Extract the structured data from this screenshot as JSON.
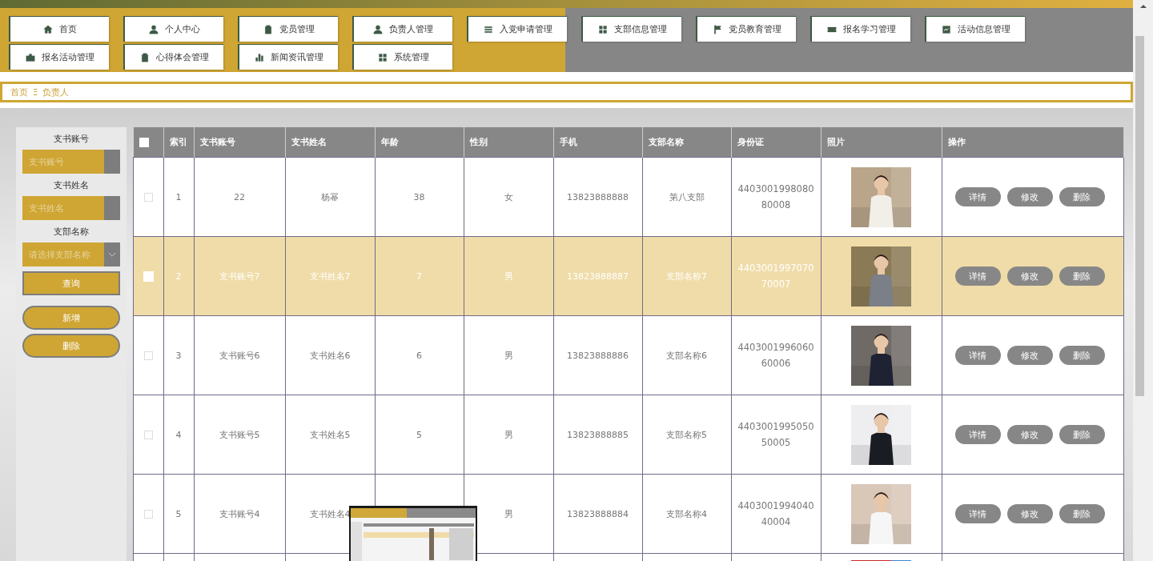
{
  "nav": [
    {
      "label": "首页"
    },
    {
      "label": "个人中心"
    },
    {
      "label": "党员管理"
    },
    {
      "label": "负责人管理"
    },
    {
      "label": "入党申请管理"
    },
    {
      "label": "支部信息管理"
    },
    {
      "label": "党员教育管理"
    },
    {
      "label": "报名学习管理"
    },
    {
      "label": "活动信息管理"
    },
    {
      "label": "报名活动管理"
    },
    {
      "label": "心得体会管理"
    },
    {
      "label": "新闻资讯管理"
    },
    {
      "label": "系统管理"
    }
  ],
  "breadcrumb": {
    "home": "首页",
    "separator": "Ξ",
    "current": "负责人"
  },
  "search": {
    "fields": [
      {
        "label": "支书账号",
        "placeholder": "支书账号",
        "kind": "input"
      },
      {
        "label": "支书姓名",
        "placeholder": "支书姓名",
        "kind": "input"
      },
      {
        "label": "支部名称",
        "placeholder": "请选择支部名称",
        "kind": "select"
      }
    ],
    "query_button": "查询",
    "add_button": "新增",
    "delete_button": "删除"
  },
  "table": {
    "columns": [
      "索引",
      "支书账号",
      "支书姓名",
      "年龄",
      "性别",
      "手机",
      "支部名称",
      "身份证",
      "照片",
      "操作"
    ],
    "select_all": false,
    "rows": [
      {
        "index": "1",
        "account": "22",
        "name": "杨幂",
        "age": "38",
        "gender": "女",
        "phone": "13823888888",
        "branch": "第八支部",
        "id_card": "440300199808080008",
        "selected": false,
        "actions": [
          "详情",
          "修改",
          "删除"
        ]
      },
      {
        "index": "2",
        "account": "支书账号7",
        "name": "支书姓名7",
        "age": "7",
        "gender": "男",
        "phone": "13823888887",
        "branch": "支部名称7",
        "id_card": "440300199707070007",
        "selected": true,
        "actions": [
          "详情",
          "修改",
          "删除"
        ]
      },
      {
        "index": "3",
        "account": "支书账号6",
        "name": "支书姓名6",
        "age": "6",
        "gender": "男",
        "phone": "13823888886",
        "branch": "支部名称6",
        "id_card": "440300199606060006",
        "selected": false,
        "actions": [
          "详情",
          "修改",
          "删除"
        ]
      },
      {
        "index": "4",
        "account": "支书账号5",
        "name": "支书姓名5",
        "age": "5",
        "gender": "男",
        "phone": "13823888885",
        "branch": "支部名称5",
        "id_card": "440300199505050005",
        "selected": false,
        "actions": [
          "详情",
          "修改",
          "删除"
        ]
      },
      {
        "index": "5",
        "account": "支书账号4",
        "name": "支书姓名4",
        "gender": "男",
        "phone": "13823888884",
        "branch": "支部名称4",
        "id_card": "440300199404040004",
        "selected": false,
        "actions": [
          "详情",
          "修改",
          "删除"
        ]
      }
    ]
  }
}
